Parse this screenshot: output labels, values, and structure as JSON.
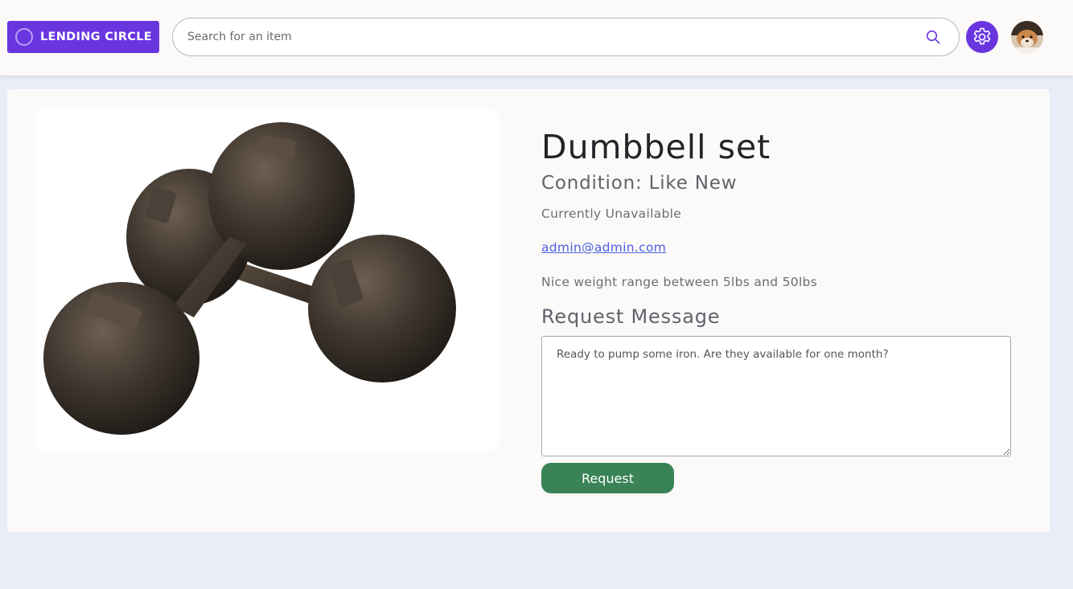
{
  "header": {
    "logo_text": "LENDING CIRCLE",
    "search_placeholder": "Search for an item",
    "accent_color": "#6935df"
  },
  "item": {
    "title": "Dumbbell set",
    "condition": "Condition: Like New",
    "availability": "Currently Unavailable",
    "owner_email": "admin@admin.com",
    "description": "Nice weight range between 5lbs and 50lbs",
    "image_icon": "dumbbell-photo"
  },
  "request": {
    "heading": "Request Message",
    "message_value": "Ready to pump some iron. Are they available for one month?",
    "button_label": "Request",
    "button_color": "#398356"
  }
}
